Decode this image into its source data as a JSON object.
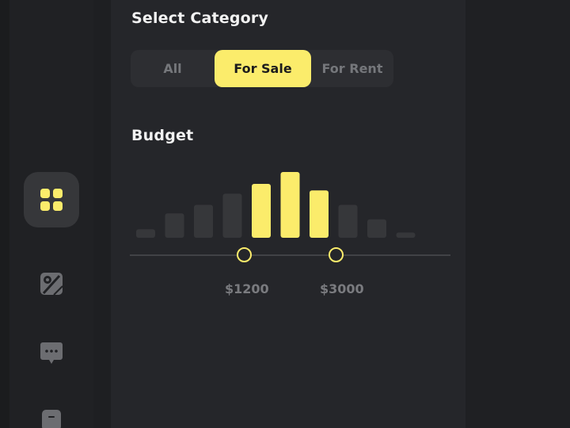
{
  "category": {
    "title": "Select Category",
    "options": [
      "All",
      "For Sale",
      "For Rent"
    ],
    "selected": "For Sale"
  },
  "budget": {
    "title": "Budget",
    "min_label": "$1200",
    "max_label": "$3000",
    "histogram": {
      "heights": [
        0.13,
        0.37,
        0.5,
        0.67,
        0.82,
        1.0,
        0.72,
        0.5,
        0.28,
        0.08
      ],
      "selected_range": [
        4,
        6
      ]
    }
  },
  "sidebar": {
    "items": [
      "grid-icon",
      "map-icon",
      "chat-icon",
      "profile-icon"
    ],
    "active": "grid-icon"
  },
  "colors": {
    "accent": "#fbec6b",
    "bar_inactive": "#36373a",
    "panel": "#25262a",
    "sidebar": "#202124"
  }
}
